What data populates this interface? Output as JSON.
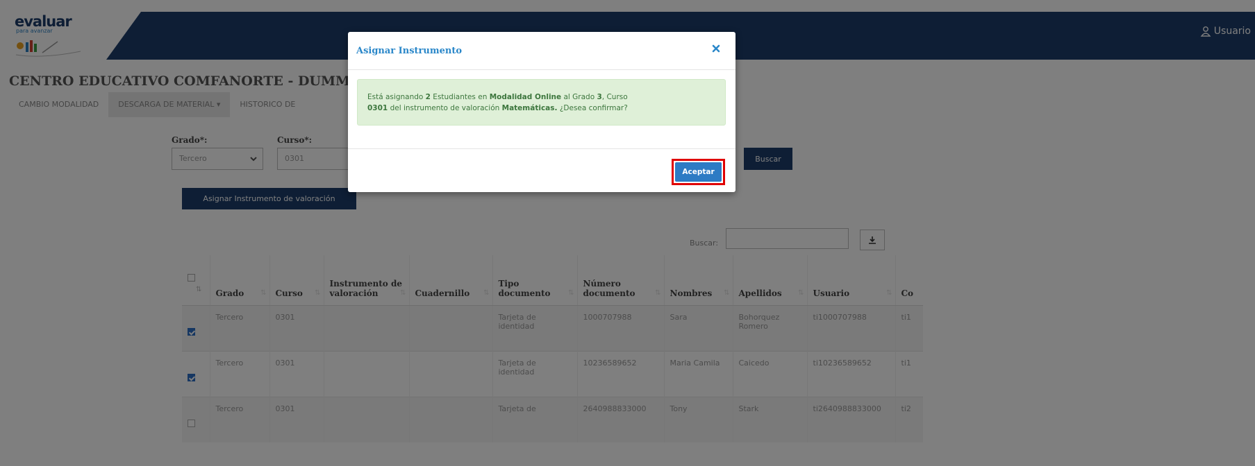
{
  "header": {
    "logo_word": "evaluar",
    "logo_sub": "para avanzar",
    "user_label": "Usuario"
  },
  "page_title": "CENTRO EDUCATIVO COMFANORTE - DUMMY - PRU",
  "nav": [
    "CAMBIO MODALIDAD",
    "DESCARGA DE MATERIAL ▾",
    "HISTORICO DE"
  ],
  "filters": {
    "grado_label": "Grado*:",
    "grado_value": "Tercero",
    "curso_label": "Curso*:",
    "curso_value": "0301",
    "search_button": "Buscar"
  },
  "assign_button": "Asignar Instrumento de valoración",
  "search_label": "Buscar:",
  "table": {
    "headers": [
      "Grado",
      "Curso",
      "Instrumento de valoración",
      "Cuadernillo",
      "Tipo documento",
      "Número documento",
      "Nombres",
      "Apellidos",
      "Usuario",
      "Co"
    ],
    "rows": [
      {
        "checked": true,
        "grado": "Tercero",
        "curso": "0301",
        "instrumento": "",
        "cuadernillo": "",
        "tipo": "Tarjeta de identidad",
        "numero": "1000707988",
        "nombres": "Sara",
        "apellidos": "Bohorquez Romero",
        "usuario": "ti1000707988",
        "co": "ti1"
      },
      {
        "checked": true,
        "grado": "Tercero",
        "curso": "0301",
        "instrumento": "",
        "cuadernillo": "",
        "tipo": "Tarjeta de identidad",
        "numero": "10236589652",
        "nombres": "Maria Camila",
        "apellidos": "Caicedo",
        "usuario": "ti10236589652",
        "co": "ti1"
      },
      {
        "checked": false,
        "grado": "Tercero",
        "curso": "0301",
        "instrumento": "",
        "cuadernillo": "",
        "tipo": "Tarjeta de",
        "numero": "2640988833000",
        "nombres": "Tony",
        "apellidos": "Stark",
        "usuario": "ti2640988833000",
        "co": "ti2"
      }
    ]
  },
  "modal": {
    "title": "Asignar Instrumento",
    "message": {
      "p1": "Está asignando ",
      "count": "2",
      "p2": " Estudiantes en ",
      "modalidad": "Modalidad Online",
      "p3": " al Grado ",
      "grado": "3",
      "p4": ", Curso ",
      "curso": "0301",
      "p5": " del instrumento de valoración ",
      "instrumento": "Matemáticas.",
      "p6": " ¿Desea confirmar?"
    },
    "accept_button": "Aceptar"
  },
  "colors": {
    "header_bg": "#1d3d6a",
    "modal_title": "#2a87c9",
    "alert_bg": "#dff0d8",
    "accept_bg": "#2d7bc4",
    "highlight": "#e00000"
  }
}
